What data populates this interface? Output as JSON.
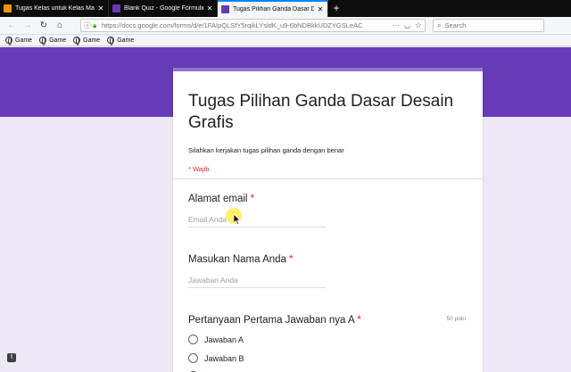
{
  "browser": {
    "tabs": [
      {
        "label": "Tugas Kelas untuk Kelas Maya",
        "favicon_color": "#f79400"
      },
      {
        "label": "Blank Quiz - Google Formulir",
        "favicon_color": "#673ab7"
      },
      {
        "label": "Tugas Pilihan Ganda Dasar Desain",
        "favicon_color": "#673ab7"
      }
    ],
    "url": "https://docs.google.com/forms/d/e/1FAIpQLSfY5rqikLYsldK_u9-6bNDBkkUDZYGSLeAC",
    "search_placeholder": "Search",
    "bookmarks": [
      "Game",
      "Game",
      "Game",
      "Game"
    ]
  },
  "form": {
    "title": "Tugas Pilihan Ganda Dasar Desain Grafis",
    "description": "Silahkan kerjakan tugas pilihan ganda dengan benar",
    "required_note": "* Wajib",
    "questions": [
      {
        "title": "Alamat email",
        "required": "*",
        "placeholder": "Email Anda"
      },
      {
        "title": "Masukan Nama Anda",
        "required": "*",
        "placeholder": "Jawaban Anda"
      },
      {
        "title": "Pertanyaan Pertama Jawaban nya A",
        "required": "*",
        "points": "50 poin",
        "options": [
          "Jawaban A",
          "Jawaban B"
        ]
      }
    ]
  },
  "colors": {
    "banner": "#673ab7",
    "background": "#ede7f6",
    "required": "#d93025",
    "tab_accent": "#0a84ff"
  },
  "feedback_button": "!"
}
